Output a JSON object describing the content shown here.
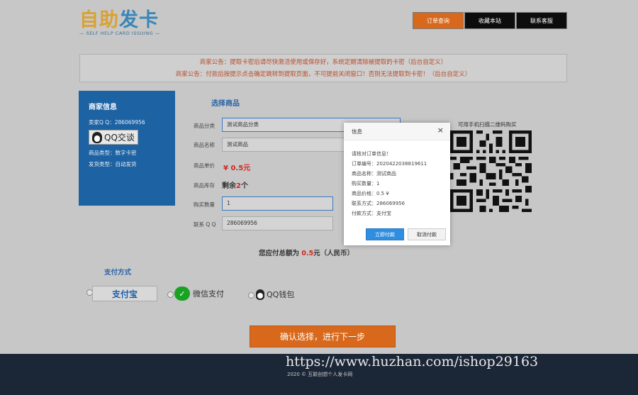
{
  "logo": {
    "main_a": "自助",
    "main_b": "发卡",
    "sub": "— SELF HELP CARD ISSUING —"
  },
  "nav": [
    {
      "label": "订单查询"
    },
    {
      "label": "收藏本站"
    },
    {
      "label": "联系客服"
    }
  ],
  "notices": [
    "商家公告：提取卡密后请尽快激活使用或保存好，系统定期清除被提取的卡密（后台自定义）",
    "商家公告：付款后按提示点击确定跳转到提取页面，不可提前关闭窗口！否则无法提取到卡密！（后台自定义）"
  ],
  "seller": {
    "title": "商家信息",
    "qq_label": "卖家Q Q：286069956",
    "qq_badge": "QQ交谈",
    "type_label": "商品类型：数字卡密",
    "ship_label": "发货类型：自动发货"
  },
  "form": {
    "section_title": "选择商品",
    "category_label": "商品分类",
    "category_value": "测试商品分类",
    "name_label": "商品名称",
    "name_value": "测试商品",
    "price_label": "商品单价",
    "price_value": "¥ 0.5元",
    "stock_label": "商品库存",
    "stock_prefix": "剩余",
    "stock_count": "2",
    "stock_suffix": "个",
    "qty_label": "购买数量",
    "qty_value": "1",
    "contact_label": "联系 Q Q",
    "contact_value": "286069956"
  },
  "qr": {
    "title": "可用手机扫描二维码购买"
  },
  "total": {
    "prefix": "您应付总额为",
    "amount": "0.5",
    "suffix": "元（人民币）"
  },
  "payment": {
    "title": "支付方式",
    "alipay": "支付宝",
    "wechat": "微信支付",
    "qqwallet": "QQ钱包"
  },
  "confirm_button": "确认选择，进行下一步",
  "footer": {
    "watermark": "https://www.huzhan.com/ishop29163",
    "copyright": "2020 © 互联创想个人发卡网"
  },
  "dialog": {
    "title": "信息",
    "close": "×",
    "lines": [
      "请核对订单信息！",
      "订单编号：2020422038819611",
      "商品名称：测试商品",
      "购买数量：1",
      "商品价格：0.5 ¥",
      "联系方式：286069956",
      "付款方式：支付宝"
    ],
    "ok": "立即付款",
    "cancel": "取消付款"
  },
  "colors": {
    "accent": "#d8681b",
    "blue": "#1d62a3",
    "price": "#d4271e",
    "footer": "#1b2636"
  },
  "icons": [
    "qq-penguin-icon",
    "alipay-logo",
    "wechat-icon",
    "qr-code",
    "close-icon"
  ]
}
